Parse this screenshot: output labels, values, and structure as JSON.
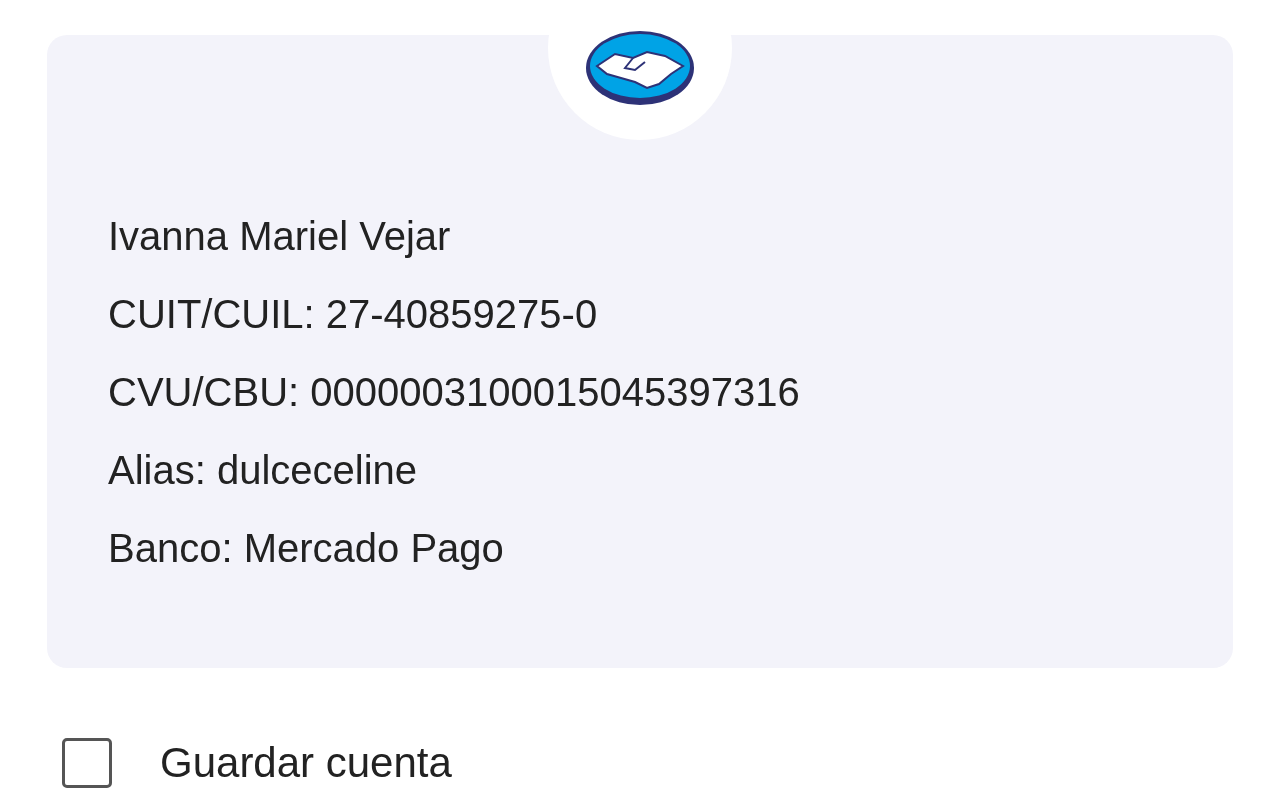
{
  "account_card": {
    "logo": {
      "kind": "handshake"
    },
    "lines": [
      "Ivanna Mariel Vejar",
      "CUIT/CUIL: 27-40859275-0",
      "CVU/CBU: 0000003100015045397316",
      "Alias: dulceceline",
      "Banco: Mercado Pago"
    ]
  },
  "save_account": {
    "label": "Guardar cuenta",
    "checked": false
  }
}
